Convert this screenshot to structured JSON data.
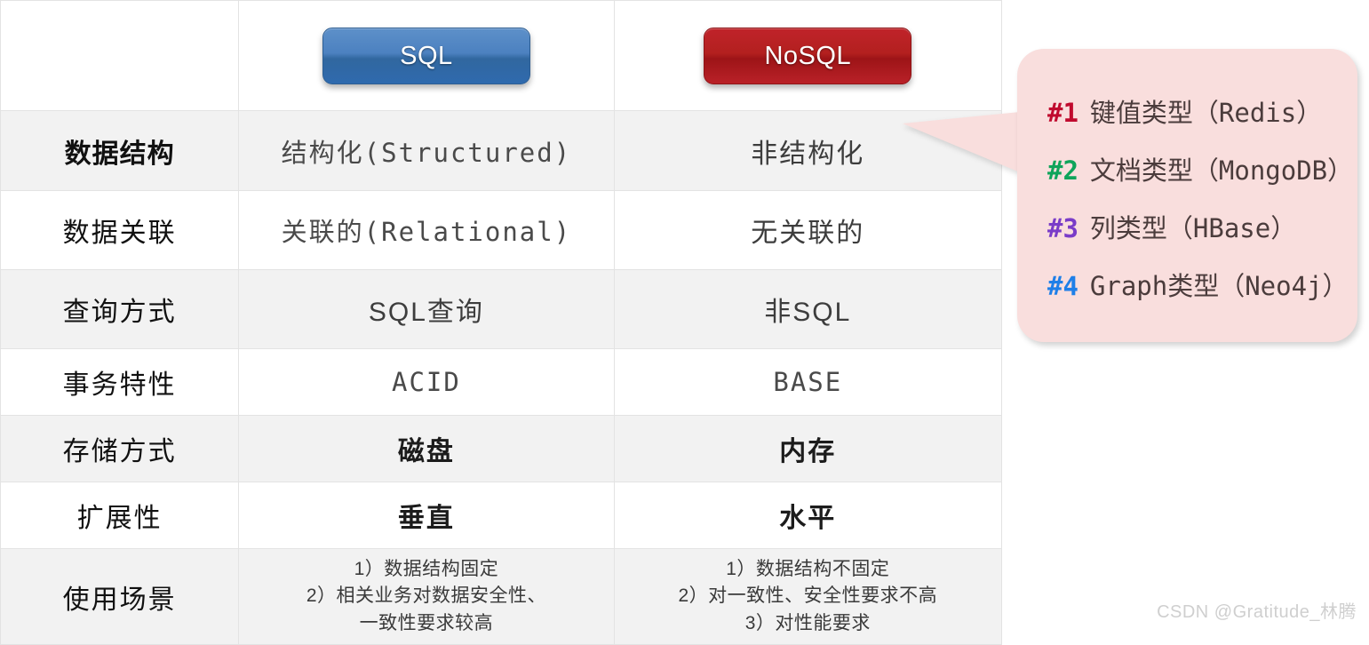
{
  "table": {
    "header": {
      "label_col": "",
      "sql_label": "SQL",
      "nosql_label": "NoSQL",
      "sql_color": "#3b72b0",
      "nosql_color": "#b3201f"
    },
    "rows": [
      {
        "label": "数据结构",
        "sql": "结构化(Structured)",
        "nosql": "非结构化"
      },
      {
        "label": "数据关联",
        "sql": "关联的(Relational)",
        "nosql": "无关联的"
      },
      {
        "label": "查询方式",
        "sql": "SQL查询",
        "nosql": "非SQL"
      },
      {
        "label": "事务特性",
        "sql": "ACID",
        "nosql": "BASE"
      },
      {
        "label": "存储方式",
        "sql": "磁盘",
        "nosql": "内存"
      },
      {
        "label": "扩展性",
        "sql": "垂直",
        "nosql": "水平"
      }
    ],
    "usecase": {
      "label": "使用场景",
      "sql_lines": [
        "1）数据结构固定",
        "2）相关业务对数据安全性、",
        "一致性要求较高"
      ],
      "nosql_lines": [
        "1）数据结构不固定",
        "2）对一致性、安全性要求不高",
        "3）对性能要求"
      ]
    }
  },
  "callout": {
    "background": "#f9dedd",
    "items": [
      {
        "num": "#1",
        "text": "键值类型（Redis）",
        "color": "#c00a2e"
      },
      {
        "num": "#2",
        "text": "文档类型（MongoDB）",
        "color": "#0fa45a"
      },
      {
        "num": "#3",
        "text": "列类型（HBase）",
        "color": "#7a3cc8"
      },
      {
        "num": "#4",
        "text": "Graph类型（Neo4j）",
        "color": "#1f7fe8"
      }
    ]
  },
  "watermark": {
    "text": "CSDN @Gratitude_林腾"
  }
}
